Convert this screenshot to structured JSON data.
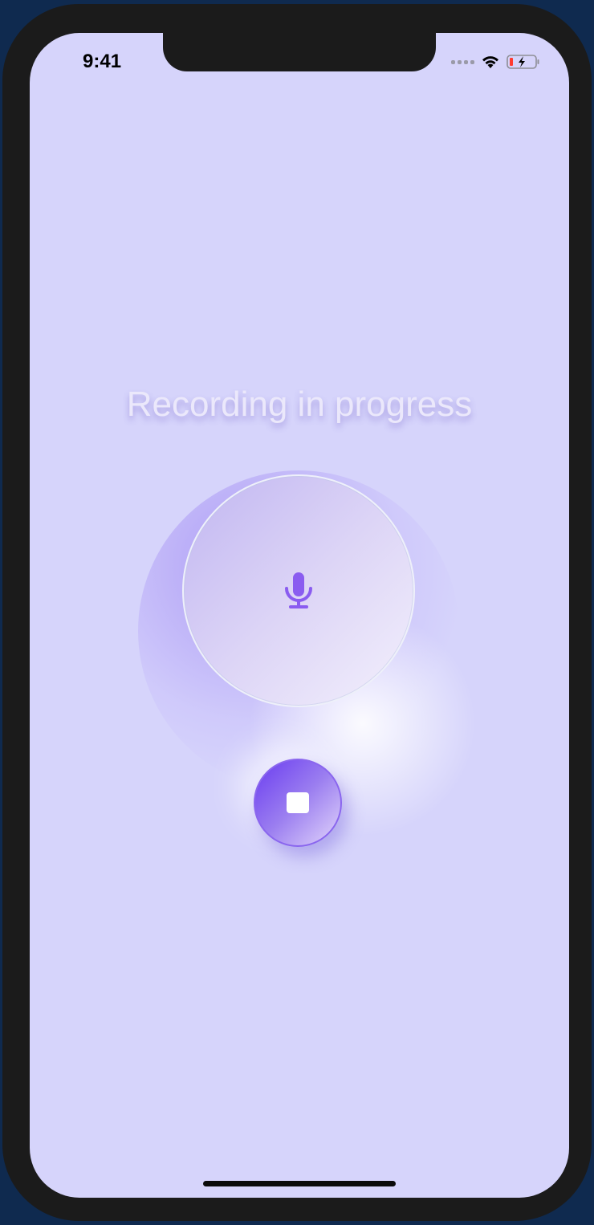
{
  "status_bar": {
    "time": "9:41",
    "icons": [
      "signal-icon",
      "wifi-icon",
      "battery-charging-icon"
    ],
    "battery_color": "#ff3b30"
  },
  "main": {
    "title": "Recording in progress",
    "mic_icon": "microphone-icon",
    "stop_icon": "stop-icon"
  },
  "colors": {
    "background": "#d6d4fb",
    "accent": "#7b4ff0",
    "mic": "#8a5cf0"
  }
}
